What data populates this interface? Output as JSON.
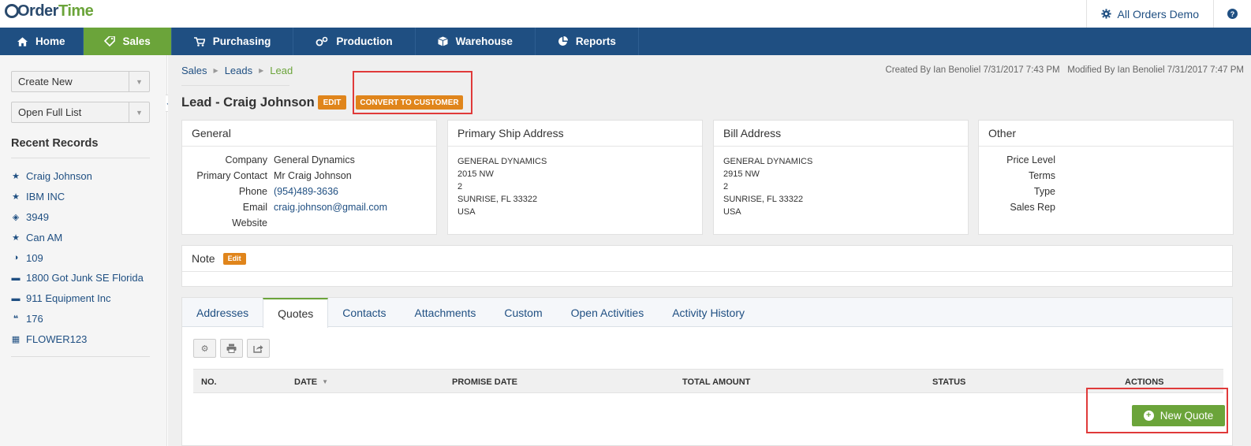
{
  "app": {
    "logo": {
      "part1": "Order",
      "part2": "Time"
    },
    "account_label": "All Orders Demo",
    "help_label": "?"
  },
  "nav": {
    "items": [
      {
        "label": "Home",
        "icon": "home-icon"
      },
      {
        "label": "Sales",
        "icon": "tag-icon",
        "active": true
      },
      {
        "label": "Purchasing",
        "icon": "cart-icon"
      },
      {
        "label": "Production",
        "icon": "gears-icon"
      },
      {
        "label": "Warehouse",
        "icon": "box-icon"
      },
      {
        "label": "Reports",
        "icon": "pie-chart-icon"
      }
    ]
  },
  "sidebar": {
    "create_new": "Create New",
    "open_full_list": "Open Full List",
    "recent_title": "Recent Records",
    "recent": [
      {
        "label": "Craig Johnson",
        "icon": "star-icon"
      },
      {
        "label": "IBM INC",
        "icon": "star-icon"
      },
      {
        "label": "3949",
        "icon": "tag-icon"
      },
      {
        "label": "Can AM",
        "icon": "star-icon"
      },
      {
        "label": "109",
        "icon": "half-circle-icon"
      },
      {
        "label": "1800 Got Junk SE Florida",
        "icon": "archive-icon"
      },
      {
        "label": "911 Equipment Inc",
        "icon": "archive-icon"
      },
      {
        "label": "176",
        "icon": "quote-icon"
      },
      {
        "label": "FLOWER123",
        "icon": "grid-icon"
      }
    ]
  },
  "breadcrumb": {
    "sales": "Sales",
    "leads": "Leads",
    "lead": "Lead"
  },
  "meta": {
    "created": "Created By Ian Benoliel 7/31/2017 7:43 PM",
    "modified": "Modified By Ian Benoliel 7/31/2017 7:47 PM"
  },
  "lead": {
    "title": "Lead - Craig Johnson",
    "edit_label": "EDIT",
    "convert_label": "CONVERT TO CUSTOMER"
  },
  "general": {
    "title": "General",
    "company_label": "Company",
    "company": "General Dynamics",
    "contact_label": "Primary Contact",
    "contact": "Mr Craig Johnson",
    "phone_label": "Phone",
    "phone": "(954)489-3636",
    "email_label": "Email",
    "email": "craig.johnson@gmail.com",
    "website_label": "Website",
    "website": ""
  },
  "ship_address": {
    "title": "Primary Ship Address",
    "line1": "GENERAL DYNAMICS",
    "line2": "2015 NW",
    "line3": "2",
    "line4": "SUNRISE, FL 33322",
    "line5": "USA"
  },
  "bill_address": {
    "title": "Bill Address",
    "line1": "GENERAL DYNAMICS",
    "line2": "2915 NW",
    "line3": "2",
    "line4": "SUNRISE, FL 33322",
    "line5": "USA"
  },
  "other": {
    "title": "Other",
    "price_level_label": "Price Level",
    "terms_label": "Terms",
    "type_label": "Type",
    "sales_rep_label": "Sales Rep"
  },
  "note": {
    "title": "Note",
    "edit_label": "Edit"
  },
  "tabs": [
    "Addresses",
    "Quotes",
    "Contacts",
    "Attachments",
    "Custom",
    "Open Activities",
    "Activity History"
  ],
  "active_tab": "Quotes",
  "grid": {
    "columns": [
      "NO.",
      "DATE",
      "PROMISE DATE",
      "TOTAL AMOUNT",
      "STATUS",
      "ACTIONS"
    ]
  },
  "new_quote_label": "New Quote",
  "colors": {
    "nav_blue": "#1f4f82",
    "sales_green": "#6ba43a",
    "orange": "#e0851b",
    "highlight_red": "#e03a3a"
  }
}
